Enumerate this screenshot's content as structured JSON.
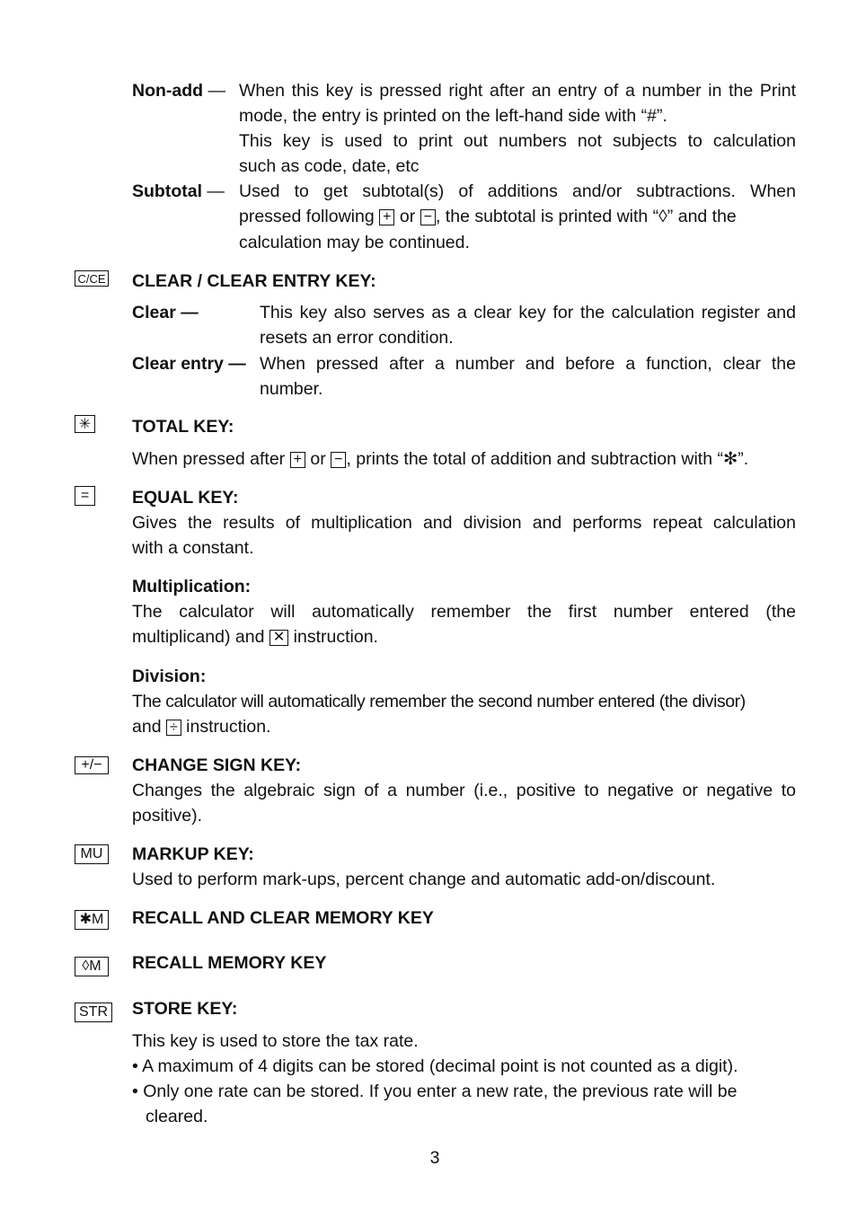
{
  "document": {
    "page_number": "3",
    "print_section": {
      "nonadd": {
        "term": "Non-add",
        "dash": "—",
        "lines": [
          "When this key is pressed right after an entry of a number in the Print",
          "mode, the entry is printed on the left-hand side with “#”.",
          "This key is used to print out numbers not subjects to calculation",
          "such as code, date, etc"
        ]
      },
      "subtotal": {
        "term": "Subtotal",
        "dash": "—",
        "line1": "Used to get subtotal(s) of additions and/or subtractions. When",
        "line2_pre": "pressed following",
        "key_plus": "+",
        "or": "or",
        "key_minus": "−",
        "line2_post": ", the subtotal is printed with “◊” and the",
        "line3": "calculation may be continued."
      }
    },
    "clear_key": {
      "icon_label": "C/CE",
      "heading": "CLEAR / CLEAR ENTRY KEY:",
      "clear": {
        "term": "Clear —",
        "lines": [
          "This key also serves as a clear key for the calculation register and",
          "resets an error condition."
        ]
      },
      "clear_entry": {
        "term": "Clear entry —",
        "lines": [
          "When pressed after a number and before a function, clear the",
          "number."
        ]
      }
    },
    "total_key": {
      "icon_label": "✳",
      "heading": "TOTAL KEY:",
      "pre": "When pressed after",
      "key_plus": "+",
      "or": "or",
      "key_minus": "−",
      "post": ", prints the total of addition and subtraction with  “✻”."
    },
    "equal_key": {
      "icon_label": "=",
      "heading": "EQUAL KEY:",
      "lines": [
        "Gives the results of multiplication and division and performs repeat calculation",
        "with a constant."
      ],
      "multiplication": {
        "heading": "Multiplication:",
        "line1": "The calculator will automatically remember the first number entered (the",
        "line2_pre": "multiplicand) and",
        "key": "✕",
        "line2_post": "instruction."
      },
      "division": {
        "heading": "Division:",
        "line1": "The calculator will automatically remember the second number entered (the divisor)",
        "line2_pre": "and",
        "key": "÷",
        "line2_post": "instruction."
      }
    },
    "change_sign_key": {
      "icon_label": "+/−",
      "heading": "CHANGE SIGN KEY:",
      "lines": [
        "Changes the algebraic sign of a number (i.e., positive to negative or negative to",
        "positive)."
      ]
    },
    "markup_key": {
      "icon_label": "MU",
      "heading": "MARKUP KEY:",
      "lines": [
        "Used to perform mark-ups, percent change and automatic add-on/discount."
      ]
    },
    "recall_clear_memory_key": {
      "icon_label": "✱M",
      "heading": "RECALL AND CLEAR MEMORY KEY"
    },
    "recall_memory_key": {
      "icon_label": "◊M",
      "heading": "RECALL MEMORY KEY"
    },
    "store_key": {
      "icon_label": "STR",
      "heading": "STORE KEY:",
      "intro": "This key is used to store the tax rate.",
      "bullets": [
        "• A maximum of 4 digits can be stored (decimal point is not counted as a digit).",
        "• Only one rate can be stored. If you enter a new rate, the previous rate will be"
      ],
      "bullet2_cont": "cleared."
    }
  }
}
